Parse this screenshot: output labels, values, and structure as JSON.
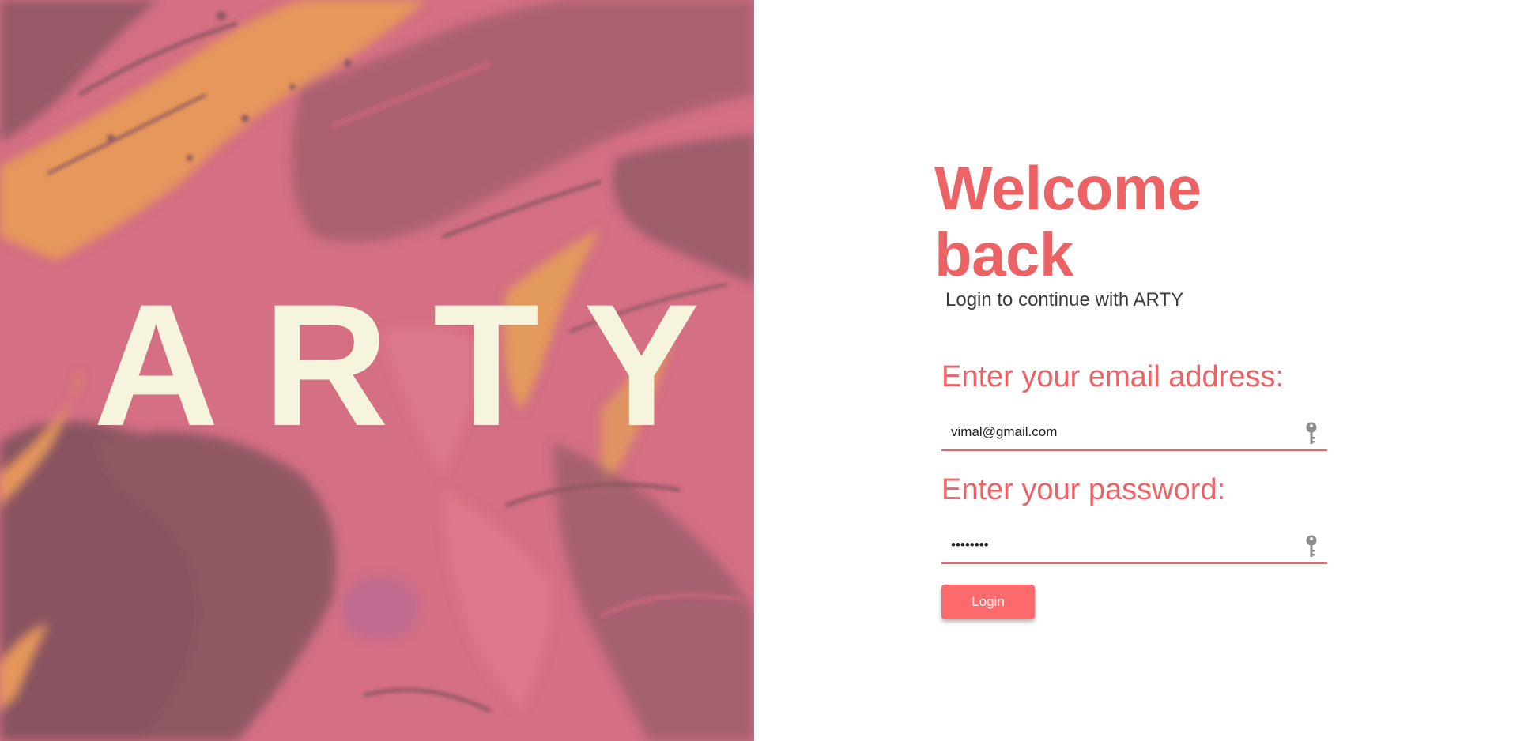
{
  "hero": {
    "brand": "ARTY"
  },
  "login": {
    "title": "Welcome back",
    "subtitle": "Login to continue with ARTY",
    "email_label": "Enter your email address:",
    "email_value": "vimal@gmail.com",
    "password_label": "Enter your password:",
    "password_value": "vimalpas",
    "button_label": "Login"
  },
  "icons": {
    "email_field_icon": "key-icon",
    "password_field_icon": "key-icon"
  },
  "colors": {
    "accent": "#ec6366",
    "button": "#fd6a6c",
    "hero_text": "#f6f4dd",
    "hero_pink": "#d46f84",
    "hero_dark": "#8c5661",
    "hero_orange": "#e6975c"
  }
}
